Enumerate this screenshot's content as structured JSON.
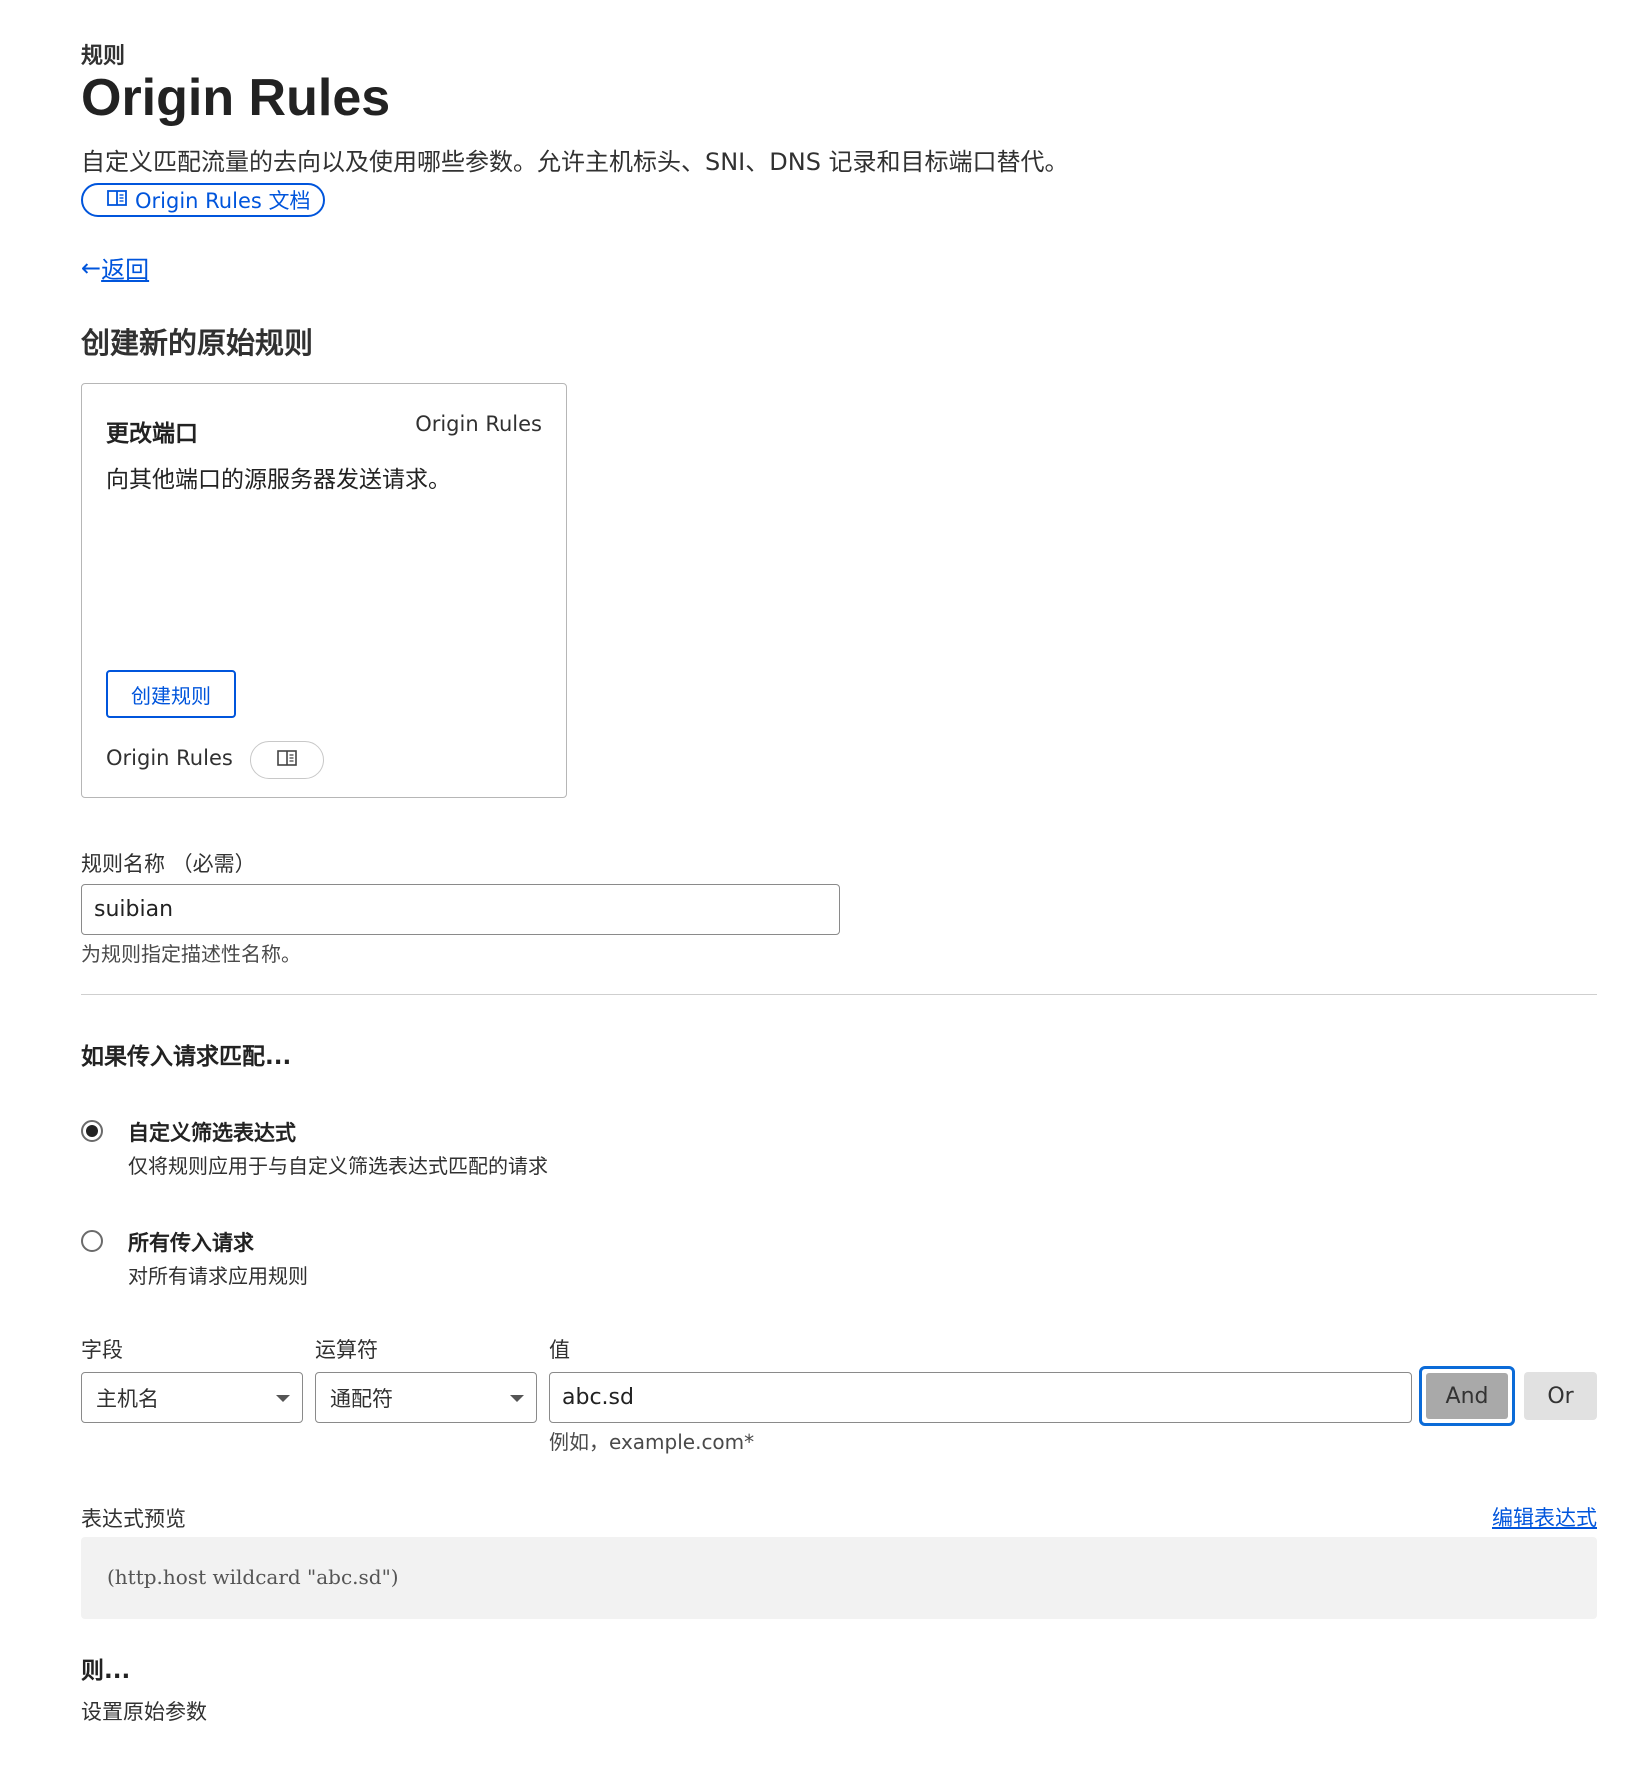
{
  "header": {
    "breadcrumb": "规则",
    "title": "Origin Rules",
    "description": "自定义匹配流量的去向以及使用哪些参数。允许主机标头、SNI、DNS 记录和目标端口替代。",
    "docs_link_label": "Origin Rules 文档"
  },
  "nav": {
    "back_arrow": "←",
    "back_label": "返回"
  },
  "section": {
    "title": "创建新的原始规则"
  },
  "template_card": {
    "title": "更改端口",
    "product": "Origin Rules",
    "description": "向其他端口的源服务器发送请求。",
    "create_button": "创建规则",
    "footer_label": "Origin Rules",
    "doc_icon": "book-icon"
  },
  "rule_name": {
    "label": "规则名称 （必需）",
    "value": "suibian",
    "help": "为规则指定描述性名称。"
  },
  "match": {
    "heading": "如果传入请求匹配...",
    "options": [
      {
        "title": "自定义筛选表达式",
        "description": "仅将规则应用于与自定义筛选表达式匹配的请求",
        "selected": true
      },
      {
        "title": "所有传入请求",
        "description": "对所有请求应用规则",
        "selected": false
      }
    ]
  },
  "expression_builder": {
    "field_label": "字段",
    "operator_label": "运算符",
    "value_label": "值",
    "field_value": "主机名",
    "operator_value": "通配符",
    "value_value": "abc.sd",
    "value_help": "例如，example.com*",
    "and_label": "And",
    "or_label": "Or"
  },
  "preview": {
    "label": "表达式预览",
    "edit_link": "编辑表达式",
    "code": "(http.host wildcard \"abc.sd\")"
  },
  "then": {
    "heading": "则...",
    "subtext": "设置原始参数"
  },
  "colors": {
    "link": "#0055dc",
    "focus_ring": "#0b6bd8",
    "and_active_bg": "#a9a9a9",
    "or_bg": "#e1e1e1",
    "preview_bg": "#f2f2f2"
  }
}
